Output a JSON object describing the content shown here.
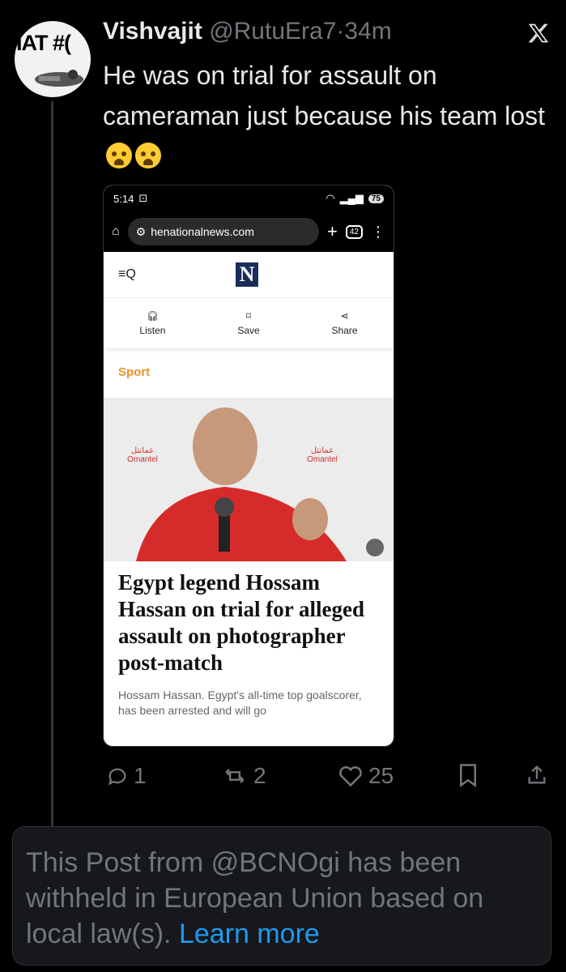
{
  "avatar": {
    "text": "IAT #("
  },
  "tweet": {
    "name": "Vishvajit",
    "handle": "@RutuEra7",
    "separator": "·",
    "time": "34m",
    "text": "He was on trial for assault on cameraman just because his team lost"
  },
  "embed": {
    "status_time": "5:14",
    "battery": "75",
    "url": "henationalnews.com",
    "tabs": "42",
    "actions": [
      "Listen",
      "Save",
      "Share"
    ],
    "section": "Sport",
    "photo_sponsor_text": [
      "Omantel",
      "عمانتل"
    ],
    "headline": "Egypt legend Hossam Hassan on trial for alleged assault on photographer post-match",
    "summary": "Hossam Hassan. Egypt's all-time top goalscorer, has been arrested and will go"
  },
  "metrics": {
    "replies": "1",
    "reposts": "2",
    "likes": "25"
  },
  "notice": {
    "text": "This Post from @BCNOgi has been withheld in European Union based on local law(s).",
    "link": "Learn more"
  },
  "colors": {
    "background": "#000000",
    "muted": "#71767b",
    "link": "#1d9bf0",
    "section": "#e8912c"
  }
}
